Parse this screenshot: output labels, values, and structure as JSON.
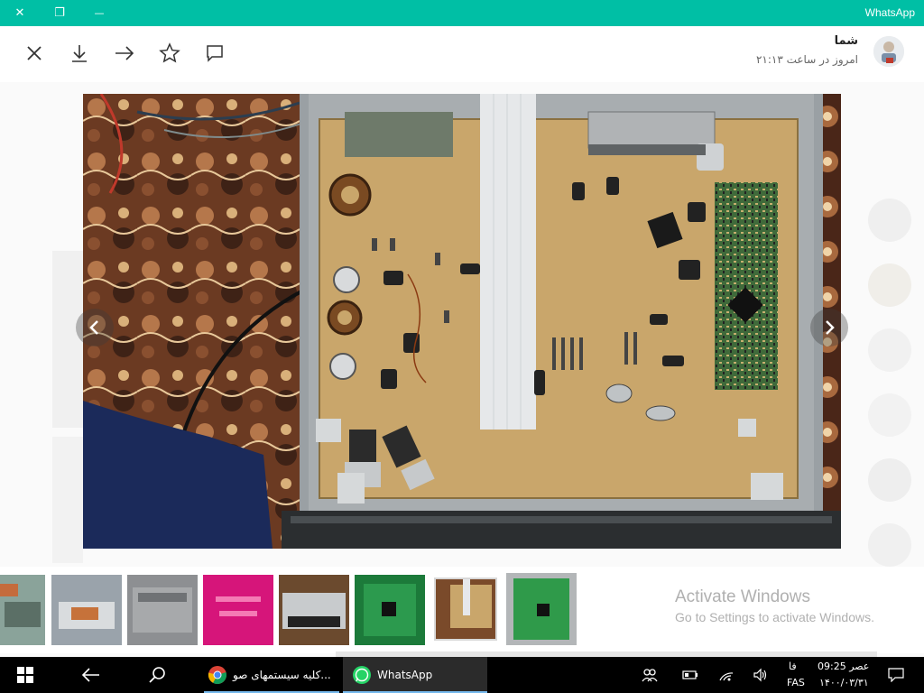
{
  "window": {
    "title": "WhatsApp",
    "close_glyph": "✕",
    "restore_glyph": "❐",
    "minimize_glyph": "—"
  },
  "viewer": {
    "sender_name": "شما",
    "timestamp": "امروز در ساعت ۲۱:۱۳",
    "tools": [
      "close-icon",
      "download-icon",
      "forward-icon",
      "star-icon",
      "comment-icon"
    ]
  },
  "watermark": {
    "line1": "Activate Windows",
    "line2": "Go to Settings to activate Windows."
  },
  "taskbar": {
    "chrome_label": "کلیه سیستمهای صو...",
    "whatsapp_label": "WhatsApp",
    "lang_top": "فا",
    "lang_bottom": "FAS",
    "time": "عصر 09:25",
    "date": "۱۴۰۰/۰۳/۳۱"
  },
  "colors": {
    "accent": "#00bfa5",
    "taskbar": "#000000",
    "pcb": "#c9a66b"
  }
}
